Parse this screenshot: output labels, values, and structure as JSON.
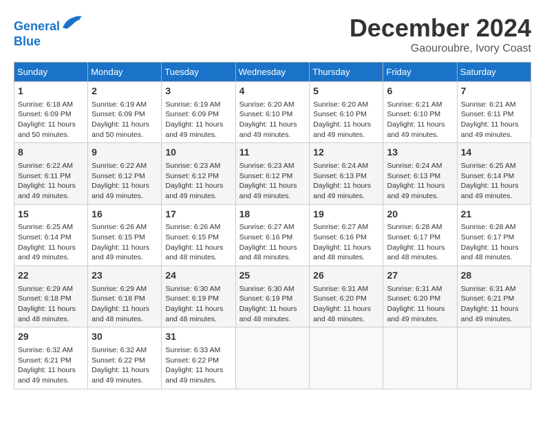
{
  "header": {
    "logo_line1": "General",
    "logo_line2": "Blue",
    "month": "December 2024",
    "location": "Gaouroubre, Ivory Coast"
  },
  "weekdays": [
    "Sunday",
    "Monday",
    "Tuesday",
    "Wednesday",
    "Thursday",
    "Friday",
    "Saturday"
  ],
  "weeks": [
    [
      {
        "day": "1",
        "sunrise": "6:18 AM",
        "sunset": "6:09 PM",
        "daylight": "11 hours and 50 minutes."
      },
      {
        "day": "2",
        "sunrise": "6:19 AM",
        "sunset": "6:09 PM",
        "daylight": "11 hours and 50 minutes."
      },
      {
        "day": "3",
        "sunrise": "6:19 AM",
        "sunset": "6:09 PM",
        "daylight": "11 hours and 49 minutes."
      },
      {
        "day": "4",
        "sunrise": "6:20 AM",
        "sunset": "6:10 PM",
        "daylight": "11 hours and 49 minutes."
      },
      {
        "day": "5",
        "sunrise": "6:20 AM",
        "sunset": "6:10 PM",
        "daylight": "11 hours and 49 minutes."
      },
      {
        "day": "6",
        "sunrise": "6:21 AM",
        "sunset": "6:10 PM",
        "daylight": "11 hours and 49 minutes."
      },
      {
        "day": "7",
        "sunrise": "6:21 AM",
        "sunset": "6:11 PM",
        "daylight": "11 hours and 49 minutes."
      }
    ],
    [
      {
        "day": "8",
        "sunrise": "6:22 AM",
        "sunset": "6:11 PM",
        "daylight": "11 hours and 49 minutes."
      },
      {
        "day": "9",
        "sunrise": "6:22 AM",
        "sunset": "6:12 PM",
        "daylight": "11 hours and 49 minutes."
      },
      {
        "day": "10",
        "sunrise": "6:23 AM",
        "sunset": "6:12 PM",
        "daylight": "11 hours and 49 minutes."
      },
      {
        "day": "11",
        "sunrise": "6:23 AM",
        "sunset": "6:12 PM",
        "daylight": "11 hours and 49 minutes."
      },
      {
        "day": "12",
        "sunrise": "6:24 AM",
        "sunset": "6:13 PM",
        "daylight": "11 hours and 49 minutes."
      },
      {
        "day": "13",
        "sunrise": "6:24 AM",
        "sunset": "6:13 PM",
        "daylight": "11 hours and 49 minutes."
      },
      {
        "day": "14",
        "sunrise": "6:25 AM",
        "sunset": "6:14 PM",
        "daylight": "11 hours and 49 minutes."
      }
    ],
    [
      {
        "day": "15",
        "sunrise": "6:25 AM",
        "sunset": "6:14 PM",
        "daylight": "11 hours and 49 minutes."
      },
      {
        "day": "16",
        "sunrise": "6:26 AM",
        "sunset": "6:15 PM",
        "daylight": "11 hours and 49 minutes."
      },
      {
        "day": "17",
        "sunrise": "6:26 AM",
        "sunset": "6:15 PM",
        "daylight": "11 hours and 48 minutes."
      },
      {
        "day": "18",
        "sunrise": "6:27 AM",
        "sunset": "6:16 PM",
        "daylight": "11 hours and 48 minutes."
      },
      {
        "day": "19",
        "sunrise": "6:27 AM",
        "sunset": "6:16 PM",
        "daylight": "11 hours and 48 minutes."
      },
      {
        "day": "20",
        "sunrise": "6:28 AM",
        "sunset": "6:17 PM",
        "daylight": "11 hours and 48 minutes."
      },
      {
        "day": "21",
        "sunrise": "6:28 AM",
        "sunset": "6:17 PM",
        "daylight": "11 hours and 48 minutes."
      }
    ],
    [
      {
        "day": "22",
        "sunrise": "6:29 AM",
        "sunset": "6:18 PM",
        "daylight": "11 hours and 48 minutes."
      },
      {
        "day": "23",
        "sunrise": "6:29 AM",
        "sunset": "6:18 PM",
        "daylight": "11 hours and 48 minutes."
      },
      {
        "day": "24",
        "sunrise": "6:30 AM",
        "sunset": "6:19 PM",
        "daylight": "11 hours and 48 minutes."
      },
      {
        "day": "25",
        "sunrise": "6:30 AM",
        "sunset": "6:19 PM",
        "daylight": "11 hours and 48 minutes."
      },
      {
        "day": "26",
        "sunrise": "6:31 AM",
        "sunset": "6:20 PM",
        "daylight": "11 hours and 48 minutes."
      },
      {
        "day": "27",
        "sunrise": "6:31 AM",
        "sunset": "6:20 PM",
        "daylight": "11 hours and 49 minutes."
      },
      {
        "day": "28",
        "sunrise": "6:31 AM",
        "sunset": "6:21 PM",
        "daylight": "11 hours and 49 minutes."
      }
    ],
    [
      {
        "day": "29",
        "sunrise": "6:32 AM",
        "sunset": "6:21 PM",
        "daylight": "11 hours and 49 minutes."
      },
      {
        "day": "30",
        "sunrise": "6:32 AM",
        "sunset": "6:22 PM",
        "daylight": "11 hours and 49 minutes."
      },
      {
        "day": "31",
        "sunrise": "6:33 AM",
        "sunset": "6:22 PM",
        "daylight": "11 hours and 49 minutes."
      },
      null,
      null,
      null,
      null
    ]
  ]
}
